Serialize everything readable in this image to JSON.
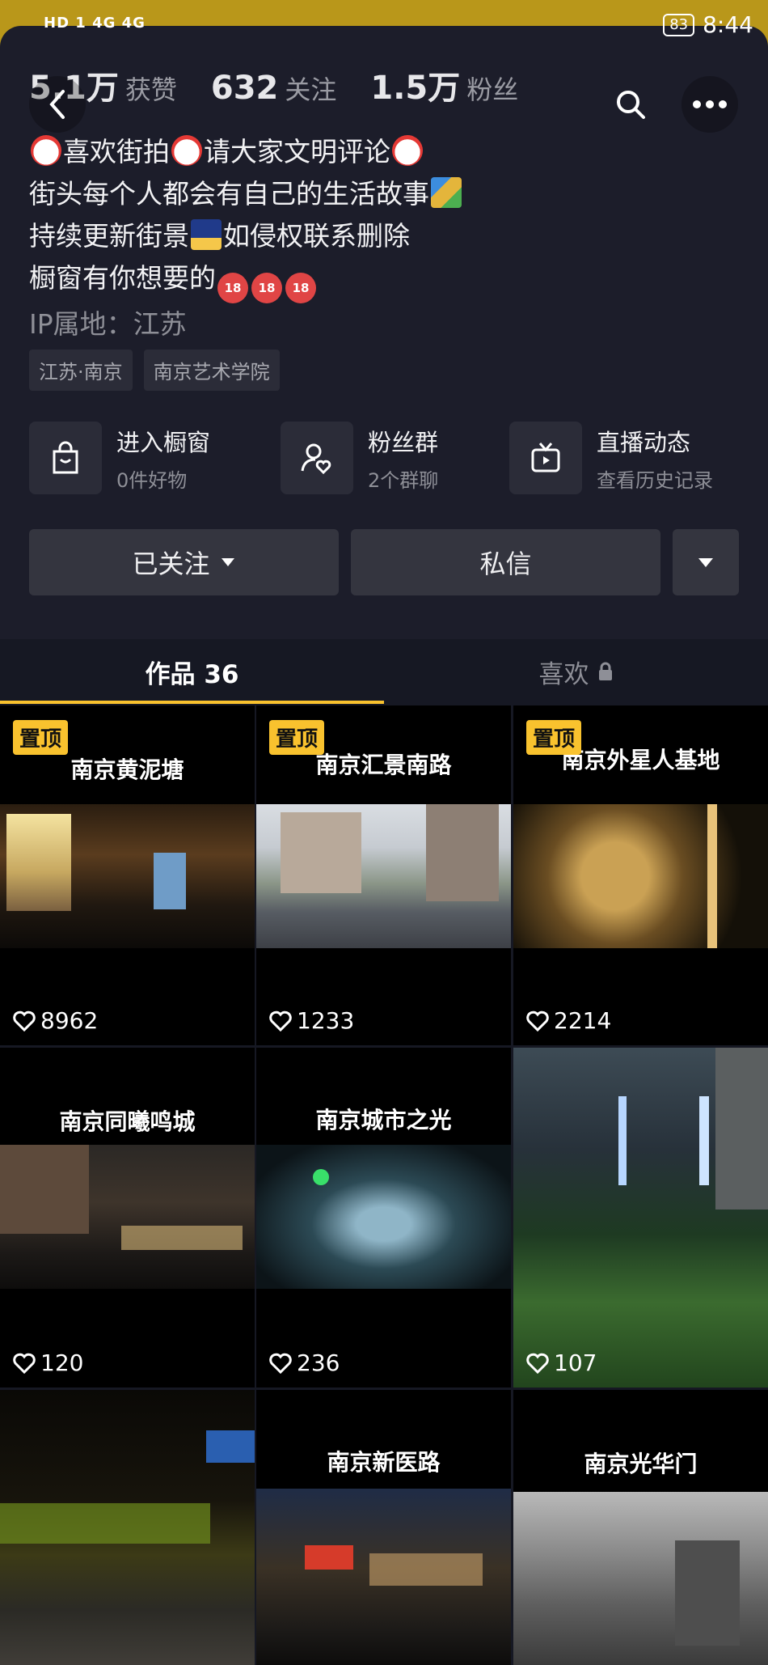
{
  "statusbar": {
    "left": "HD 1 4G 4G",
    "battery": "83",
    "time": "8:44"
  },
  "stats": [
    {
      "value": "5.1万",
      "label": "获赞"
    },
    {
      "value": "632",
      "label": "关注"
    },
    {
      "value": "1.5万",
      "label": "粉丝"
    }
  ],
  "bio": {
    "line1_a": "喜欢街拍",
    "line1_b": "请大家文明评论",
    "line2": "街头每个人都会有自己的生活故事",
    "line3_a": "持续更新街景",
    "line3_b": "如侵权联系删除",
    "line4": "橱窗有你想要的",
    "emoji_18": "18"
  },
  "ip": "IP属地：江苏",
  "tags": [
    "江苏·南京",
    "南京艺术学院"
  ],
  "entries": [
    {
      "title": "进入橱窗",
      "sub": "0件好物",
      "icon": "shopping-bag-icon"
    },
    {
      "title": "粉丝群",
      "sub": "2个群聊",
      "icon": "fans-group-icon"
    },
    {
      "title": "直播动态",
      "sub": "查看历史记录",
      "icon": "tv-icon"
    }
  ],
  "actions": {
    "follow": "已关注",
    "message": "私信"
  },
  "tabs": {
    "works": "作品 36",
    "likes": "喜欢"
  },
  "pin_label": "置顶",
  "videos": [
    {
      "title": "南京黄泥塘",
      "likes": "8962",
      "pinned": true
    },
    {
      "title": "南京汇景南路",
      "likes": "1233",
      "pinned": true
    },
    {
      "title": "南京外星人基地",
      "likes": "2214",
      "pinned": true
    },
    {
      "title": "南京同曦鸣城",
      "likes": "120",
      "pinned": false
    },
    {
      "title": "南京城市之光",
      "likes": "236",
      "pinned": false
    },
    {
      "title": "",
      "likes": "107",
      "pinned": false
    },
    {
      "title": "",
      "likes": "",
      "pinned": false
    },
    {
      "title": "南京新医路",
      "likes": "",
      "pinned": false
    },
    {
      "title": "南京光华门",
      "likes": "",
      "pinned": false
    }
  ],
  "colors": {
    "bg": "#161823",
    "accent": "#f9c22e",
    "status_bar": "#b9971a"
  }
}
